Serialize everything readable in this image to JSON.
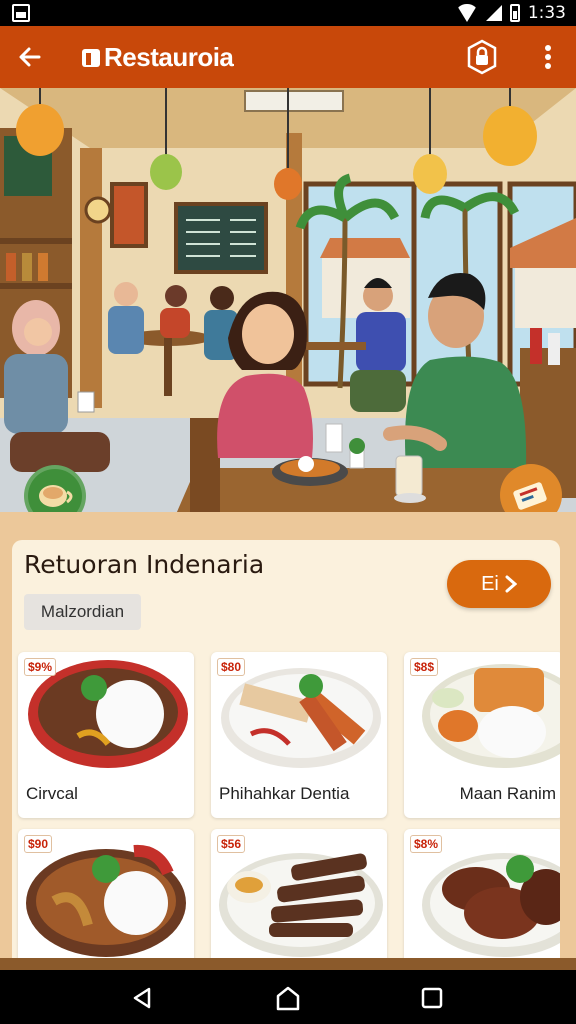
{
  "status_bar": {
    "time": "1:33",
    "icons": [
      "image-icon",
      "wifi-icon",
      "signal-icon",
      "battery-icon"
    ]
  },
  "app_bar": {
    "title": "Restauroia",
    "back_icon": "arrow-left-icon",
    "action_icon": "lock-icon",
    "overflow_icon": "more-vert-icon",
    "color": "#c8480a"
  },
  "hero": {
    "image": "restaurant-interior-illustration",
    "left_badge_icon": "coffee-cup-icon",
    "right_badge_icon": "ticket-icon"
  },
  "restaurant": {
    "name": "Retuoran Indenaria",
    "location": "Malzordian",
    "go_button_label": "Ei"
  },
  "menu": [
    {
      "price": "$9%",
      "name": "Cirvcal"
    },
    {
      "price": "$80",
      "name": "Phihahkar Dentia"
    },
    {
      "price": "$8$",
      "name": "Maan Ranim"
    },
    {
      "price": "$90",
      "name": ""
    },
    {
      "price": "$56",
      "name": ""
    },
    {
      "price": "$8%",
      "name": ""
    }
  ],
  "nav_bar": {
    "icons": [
      "back-triangle-icon",
      "home-icon",
      "recents-icon"
    ]
  },
  "colors": {
    "accent": "#d9690e",
    "price_red": "#c8240a",
    "card_bg": "#fbf1dd"
  }
}
